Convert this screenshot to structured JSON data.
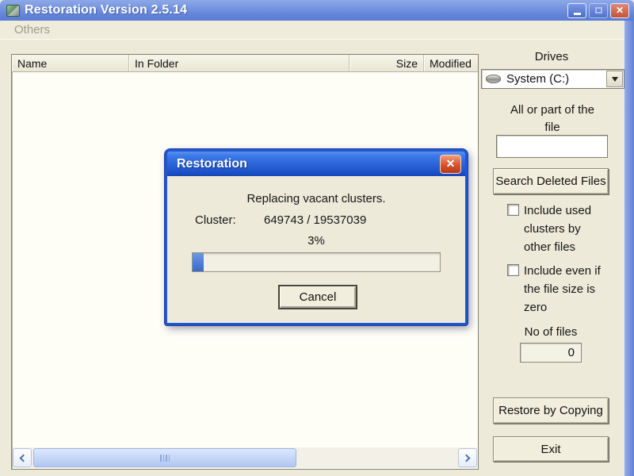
{
  "window": {
    "title": "Restoration Version 2.5.14",
    "menu_others": "Others"
  },
  "list": {
    "columns": [
      "Name",
      "In Folder",
      "Size",
      "Modified"
    ]
  },
  "panel": {
    "drives_label": "Drives",
    "drive_selected": "System (C:)",
    "file_filter_label": "All or part of the file",
    "file_filter_value": "",
    "search_button": "Search Deleted Files",
    "checkbox1_label": "Include used clusters by other files",
    "checkbox1_checked": false,
    "checkbox2_label": "Include even if the file size is zero",
    "checkbox2_checked": false,
    "no_of_files_label": "No of files",
    "no_of_files_value": "0",
    "restore_button": "Restore by Copying",
    "exit_button": "Exit"
  },
  "dialog": {
    "title": "Restoration",
    "status": "Replacing vacant clusters.",
    "cluster_label": "Cluster:",
    "cluster_value": "649743 / 19537039",
    "percent_text": "3%",
    "progress_percent": 3,
    "cancel_button": "Cancel"
  },
  "icons": {
    "close": "✕",
    "minimize": "minimize-dash",
    "maximize": "maximize-square",
    "drive": "hard-disk",
    "dropdown": "down-triangle",
    "scroll_left": "left-chevron",
    "scroll_right": "right-chevron"
  },
  "colors": {
    "bg": "#edead9",
    "titlebar-a": "#8ea9e8",
    "titlebar-b": "#6384d8",
    "dialog-title-a": "#3c79e8",
    "dialog-title-b": "#1c50c8",
    "dialog-border": "#2056d2",
    "close-red": "#d9512c",
    "progress-fill": "#4a7cd6",
    "thumb": "#c6d7f8"
  }
}
